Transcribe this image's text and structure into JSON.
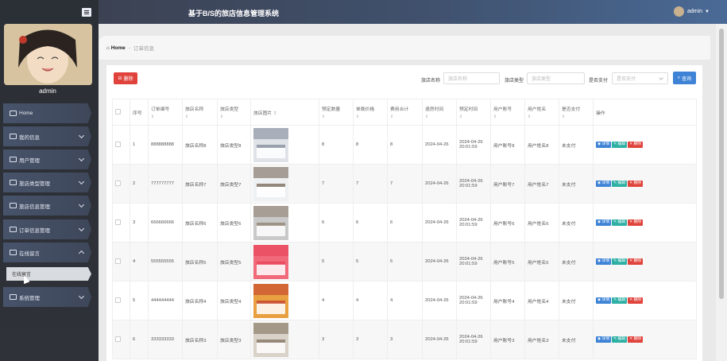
{
  "app": {
    "title": "基于B/S的旅店信息管理系统",
    "user_name": "admin"
  },
  "sidebar": {
    "admin_label": "admin",
    "items": [
      {
        "label": "Home",
        "icon": "home-icon"
      },
      {
        "label": "我的信息",
        "icon": "card-icon"
      },
      {
        "label": "用户管理",
        "icon": "users-icon"
      },
      {
        "label": "旅店类型管理",
        "icon": "chat-icon"
      },
      {
        "label": "旅店信息管理",
        "icon": "box-icon"
      },
      {
        "label": "订单信息管理",
        "icon": "doc-icon"
      },
      {
        "label": "在线留言",
        "icon": "list-icon"
      },
      {
        "label": "系统管理",
        "icon": "settings-icon"
      }
    ],
    "sub_item": "在线留言"
  },
  "breadcrumb": {
    "home": "Home",
    "separator": "-",
    "current": "订单信息"
  },
  "toolbar": {
    "delete_label": "删除",
    "hotel_name_label": "旅店名称",
    "hotel_name_placeholder": "旅店名称",
    "hotel_type_label": "旅店类型",
    "hotel_type_placeholder": "旅店类型",
    "paid_label": "是否支付",
    "paid_placeholder": "是否支付",
    "search_label": "查询"
  },
  "table": {
    "headers": [
      "序号",
      "订单编号",
      "旅店名称",
      "旅店类型",
      "旅店图片",
      "预定数量",
      "单晚价格",
      "费用合计",
      "退房时间",
      "预定时间",
      "用户账号",
      "用户姓名",
      "是否支付",
      "操作"
    ],
    "sort_marker": "⇕",
    "actions": {
      "detail": "详情",
      "edit": "编辑",
      "delete": "删除"
    },
    "rows": [
      {
        "no": "1",
        "order": "888888888",
        "name": "旅店名称8",
        "type": "旅店类型8",
        "qty": "8",
        "price": "8",
        "total": "8",
        "checkout": "2024-04-26",
        "booked": "2024-04-26 20:01:59",
        "account": "用户账号8",
        "username": "用户姓名8",
        "paid": "未支付"
      },
      {
        "no": "2",
        "order": "777777777",
        "name": "旅店名称7",
        "type": "旅店类型7",
        "qty": "7",
        "price": "7",
        "total": "7",
        "checkout": "2024-04-26",
        "booked": "2024-04-26 20:01:59",
        "account": "用户账号7",
        "username": "用户姓名7",
        "paid": "未支付"
      },
      {
        "no": "3",
        "order": "666666666",
        "name": "旅店名称6",
        "type": "旅店类型6",
        "qty": "6",
        "price": "6",
        "total": "6",
        "checkout": "2024-04-26",
        "booked": "2024-04-26 20:01:59",
        "account": "用户账号6",
        "username": "用户姓名6",
        "paid": "未支付"
      },
      {
        "no": "4",
        "order": "555555555",
        "name": "旅店名称5",
        "type": "旅店类型5",
        "qty": "5",
        "price": "5",
        "total": "5",
        "checkout": "2024-04-26",
        "booked": "2024-04-26 20:01:59",
        "account": "用户账号5",
        "username": "用户姓名5",
        "paid": "未支付"
      },
      {
        "no": "5",
        "order": "444444444",
        "name": "旅店名称4",
        "type": "旅店类型4",
        "qty": "4",
        "price": "4",
        "total": "4",
        "checkout": "2024-04-26",
        "booked": "2024-04-26 20:01:59",
        "account": "用户账号4",
        "username": "用户姓名4",
        "paid": "未支付"
      },
      {
        "no": "6",
        "order": "333333333",
        "name": "旅店名称3",
        "type": "旅店类型3",
        "qty": "3",
        "price": "3",
        "total": "3",
        "checkout": "2024-04-26",
        "booked": "2024-04-26 20:01:59",
        "account": "用户账号3",
        "username": "用户姓名3",
        "paid": "未支付"
      }
    ]
  },
  "colors": {
    "primary": "#3e83d6",
    "danger": "#e0433c",
    "teal": "#2fb0a5"
  }
}
